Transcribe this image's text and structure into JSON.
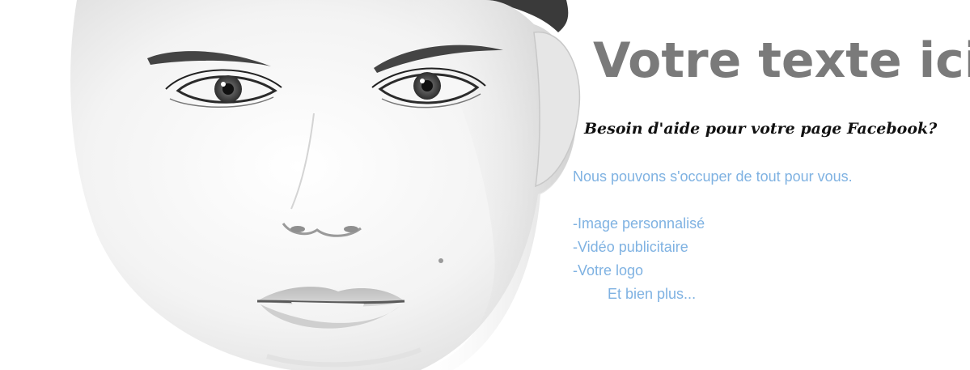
{
  "banner": {
    "title": "Votre texte ici",
    "subtitle": "Besoin d'aide pour votre page Facebook?",
    "intro": "Nous pouvons s'occuper de tout pour vous.",
    "services": [
      "-Image personnalisé",
      "-Vidéo publicitaire",
      "-Votre logo"
    ],
    "more": "Et bien plus...",
    "colors": {
      "title": "#7a7a7a",
      "subtitle": "#111111",
      "body": "#7fb2e2",
      "background": "#ffffff"
    }
  },
  "image": {
    "subject": "portrait-photo"
  }
}
